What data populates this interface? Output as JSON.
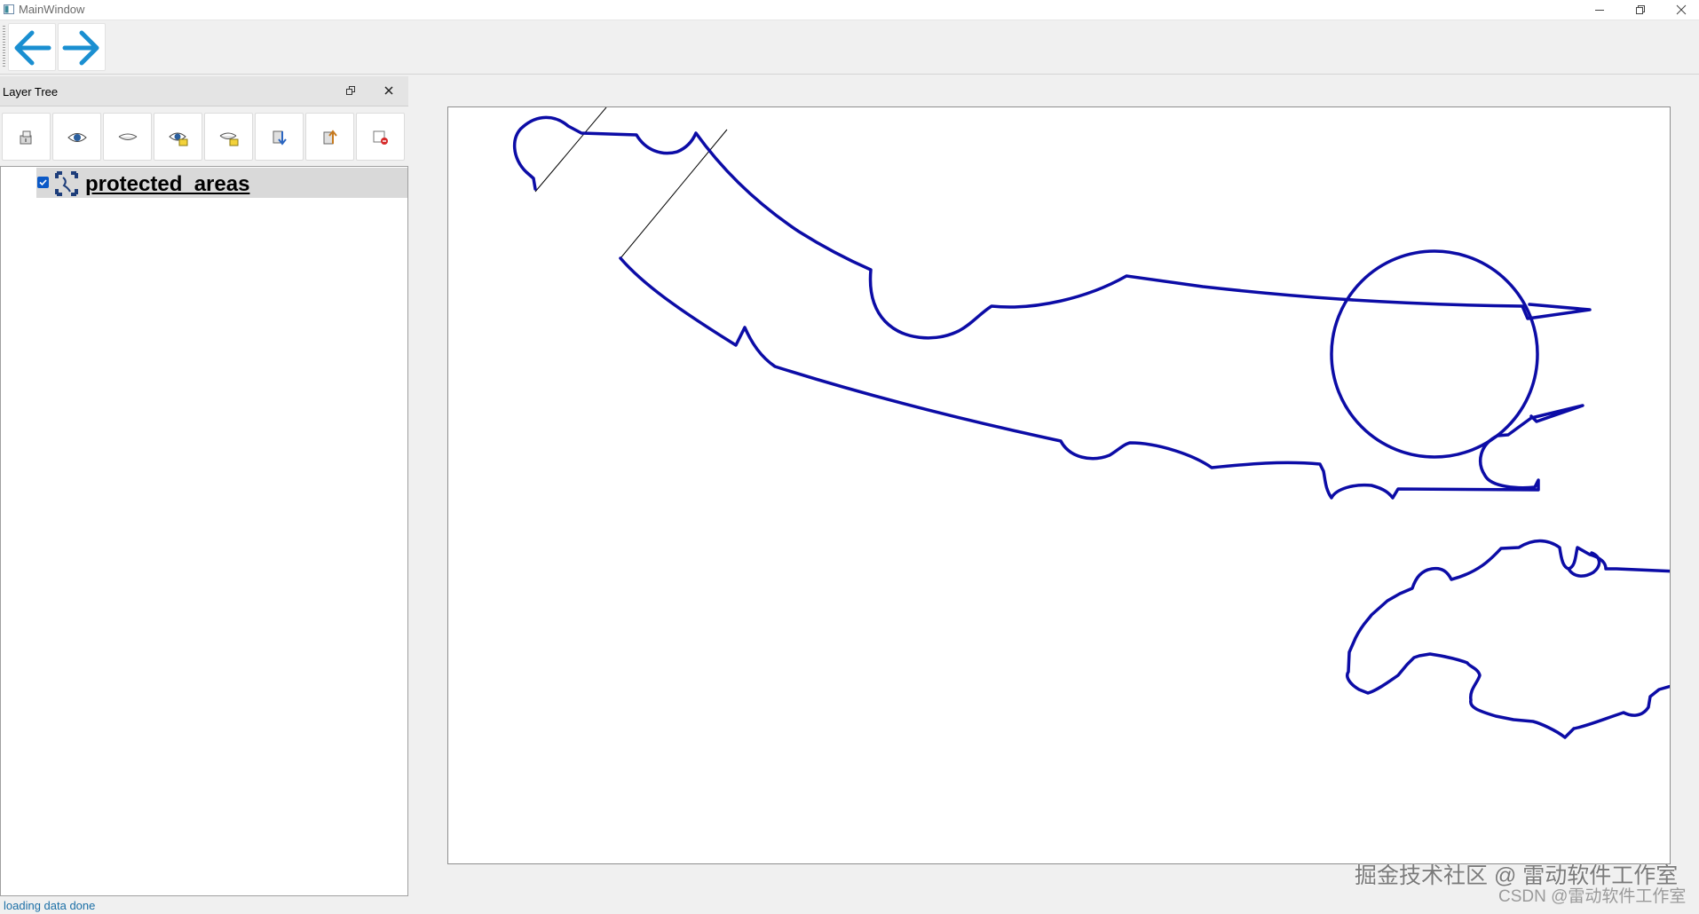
{
  "window": {
    "title": "MainWindow",
    "minimize_icon": "minimize-icon",
    "restore_icon": "restore-icon",
    "close_icon": "close-icon"
  },
  "toolbar": {
    "back_icon": "arrow-left-icon",
    "forward_icon": "arrow-right-icon",
    "arrow_color": "#1a8fd1"
  },
  "layer_tree": {
    "title": "Layer Tree",
    "tools": [
      "add-group-icon",
      "show-all-icon",
      "hide-all-icon",
      "show-selected-icon",
      "hide-selected-icon",
      "move-down-icon",
      "move-up-icon",
      "remove-layer-icon"
    ],
    "layers": [
      {
        "name": "protected_areas",
        "checked": true,
        "icon": "polygon-layer-icon"
      }
    ]
  },
  "map": {
    "line_color": "#0c0ca6",
    "background": "#ffffff"
  },
  "status": {
    "text": "loading data done"
  },
  "watermark": {
    "line1": "掘金技术社区 @ 雷动软件工作室",
    "line2": "CSDN @雷动软件工作室"
  }
}
